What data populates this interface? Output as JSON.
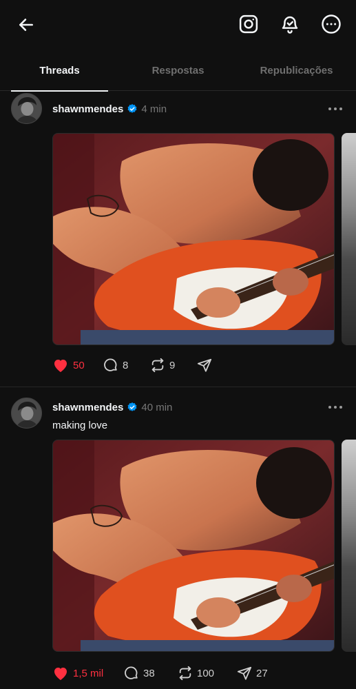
{
  "header": {
    "back_icon": "arrow-left-icon",
    "instagram_icon": "instagram-icon",
    "notify_icon": "bell-check-icon",
    "more_icon": "more-circle-icon"
  },
  "tabs": [
    {
      "label": "Threads",
      "active": true
    },
    {
      "label": "Respostas",
      "active": false
    },
    {
      "label": "Republicações",
      "active": false
    }
  ],
  "posts": [
    {
      "username": "shawnmendes",
      "verified": true,
      "time": "4 min",
      "caption": "",
      "likes": "50",
      "liked": true,
      "replies": "8",
      "reposts": "9",
      "shares": ""
    },
    {
      "username": "shawnmendes",
      "verified": true,
      "time": "40 min",
      "caption": "making love",
      "likes": "1,5 mil",
      "liked": true,
      "replies": "38",
      "reposts": "100",
      "shares": "27"
    }
  ],
  "colors": {
    "background": "#101010",
    "like_red": "#ff3040",
    "verified_blue": "#0095f6",
    "muted_text": "#777777"
  }
}
